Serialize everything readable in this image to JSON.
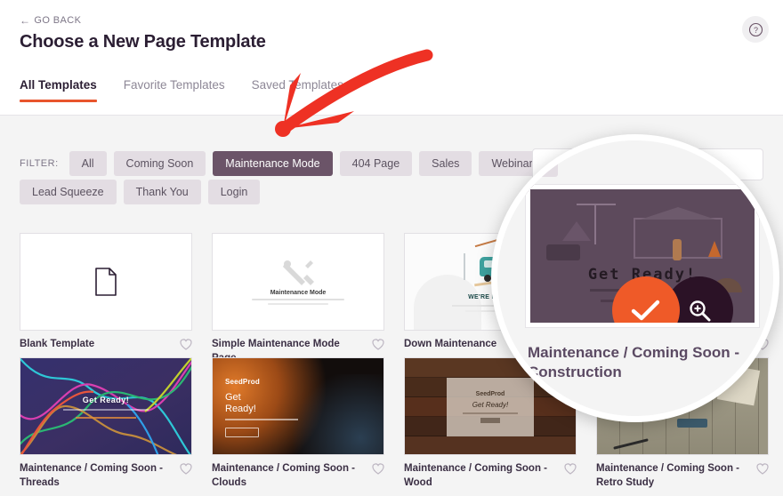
{
  "header": {
    "go_back": "GO BACK",
    "go_back_icon": "left-arrow-icon",
    "title": "Choose a New Page Template",
    "help_icon": "question-mark-icon"
  },
  "tabs": [
    {
      "label": "All Templates",
      "active": true
    },
    {
      "label": "Favorite Templates",
      "active": false
    },
    {
      "label": "Saved Templates",
      "active": false
    }
  ],
  "filter": {
    "label": "FILTER:",
    "chips": [
      {
        "label": "All",
        "active": false
      },
      {
        "label": "Coming Soon",
        "active": false
      },
      {
        "label": "Maintenance Mode",
        "active": true
      },
      {
        "label": "404 Page",
        "active": false
      },
      {
        "label": "Sales",
        "active": false
      },
      {
        "label": "Webinar",
        "active": false
      },
      {
        "label": "Lead Squeeze",
        "active": false
      },
      {
        "label": "Thank You",
        "active": false
      },
      {
        "label": "Login",
        "active": false
      }
    ]
  },
  "search": {
    "value": "",
    "placeholder": "",
    "name": "template-search-input"
  },
  "templates": [
    {
      "title": "Blank Template",
      "art": "blank",
      "favorite_icon": "heart-outline-icon"
    },
    {
      "title": "Simple Maintenance Mode Page",
      "art": "wrench",
      "favorite_icon": "heart-outline-icon"
    },
    {
      "title": "Down Maintenance",
      "art": "down",
      "favorite_icon": "heart-outline-icon"
    },
    {
      "title": "Maintenance / Coming Soon - Construction",
      "art": "construction",
      "favorite_icon": "heart-outline-icon"
    },
    {
      "title": "Maintenance / Coming Soon - Threads",
      "art": "threads",
      "favorite_icon": "heart-outline-icon"
    },
    {
      "title": "Maintenance / Coming Soon - Clouds",
      "art": "clouds",
      "favorite_icon": "heart-outline-icon"
    },
    {
      "title": "Maintenance / Coming Soon - Wood",
      "art": "wood",
      "favorite_icon": "heart-outline-icon"
    },
    {
      "title": "Maintenance / Coming Soon - Retro Study",
      "art": "typewriter",
      "favorite_icon": "heart-outline-icon"
    }
  ],
  "thumb_text": {
    "wrench_title": "Maintenance Mode",
    "down_title": "WE'RE DOWN",
    "threads_title": "Get Ready!",
    "clouds_logo": "SeedProd",
    "clouds_heading": "Get\nReady!",
    "wood_logo": "SeedProd",
    "wood_heading": "Get Ready!"
  },
  "magnifier": {
    "chip_label": "Webinar",
    "preview_title": "Get  Ready!",
    "caption": "Maintenance / Coming Soon - Construction",
    "check_icon": "checkmark-icon",
    "zoom_icon": "magnifier-plus-icon"
  },
  "annotation": {
    "arrow_icon": "red-arrow-icon",
    "arrow_color": "#ee3124",
    "points_to": "Maintenance Mode"
  },
  "colors": {
    "accent": "#e8552d",
    "active_chip": "#6b5468",
    "chip_bg": "#e3dde3",
    "page_bg": "#f4f4f4",
    "title": "#2b1e33",
    "check_circle": "#ef5a28",
    "zoom_circle": "#2b1226"
  }
}
